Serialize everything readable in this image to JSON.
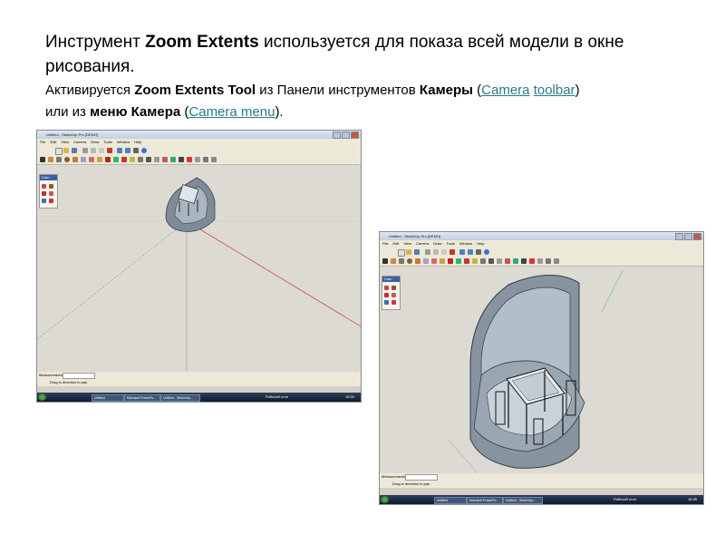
{
  "heading": {
    "line1_a": "Инструмент ",
    "line1_b": "Zoom Extents",
    "line1_c": " используется для показа всей модели в окне рисования.",
    "line2_a": "Активируется ",
    "line2_b": "Zoom Extents Tool",
    "line2_c": " из Панели инструментов  ",
    "line2_d": "Камеры",
    "line2_e": " (",
    "link_camera": "Camera",
    "line2_f": " ",
    "link_toolbar": "toolbar",
    "line2_g": ")",
    "line3_a": "или из ",
    "line3_b": "меню Камера",
    "line3_c": " (",
    "link_camera_menu": "Camera menu",
    "line3_d": ")."
  },
  "link_color": "#2a7a8a",
  "screenshots": [
    {
      "window_title": "Untitled - SketchUp Pro [DEMO]",
      "menu": [
        "File",
        "Edit",
        "View",
        "Camera",
        "Draw",
        "Tools",
        "Window",
        "Help"
      ],
      "camera_panel_title": "Cam",
      "measurements_label": "Measurements",
      "status_hint": "Drag in direction to pan",
      "taskbar_items": [
        "Untitled",
        "Microsoft PowerPo...",
        "Untitled - SketchUp..."
      ],
      "tray_lang": "Рабочий стол",
      "tray_clock": "16:34"
    },
    {
      "window_title": "Untitled - SketchUp Pro [DEMO]",
      "menu": [
        "File",
        "Edit",
        "View",
        "Camera",
        "Draw",
        "Tools",
        "Window",
        "Help"
      ],
      "camera_panel_title": "Cam",
      "measurements_label": "Measurements",
      "status_hint": "Drag in direction to pan",
      "taskbar_items": [
        "Untitled",
        "Microsoft PowerPo...",
        "Untitled - SketchUp..."
      ],
      "tray_lang": "Рабочий стол",
      "tray_clock": "16:35"
    }
  ]
}
